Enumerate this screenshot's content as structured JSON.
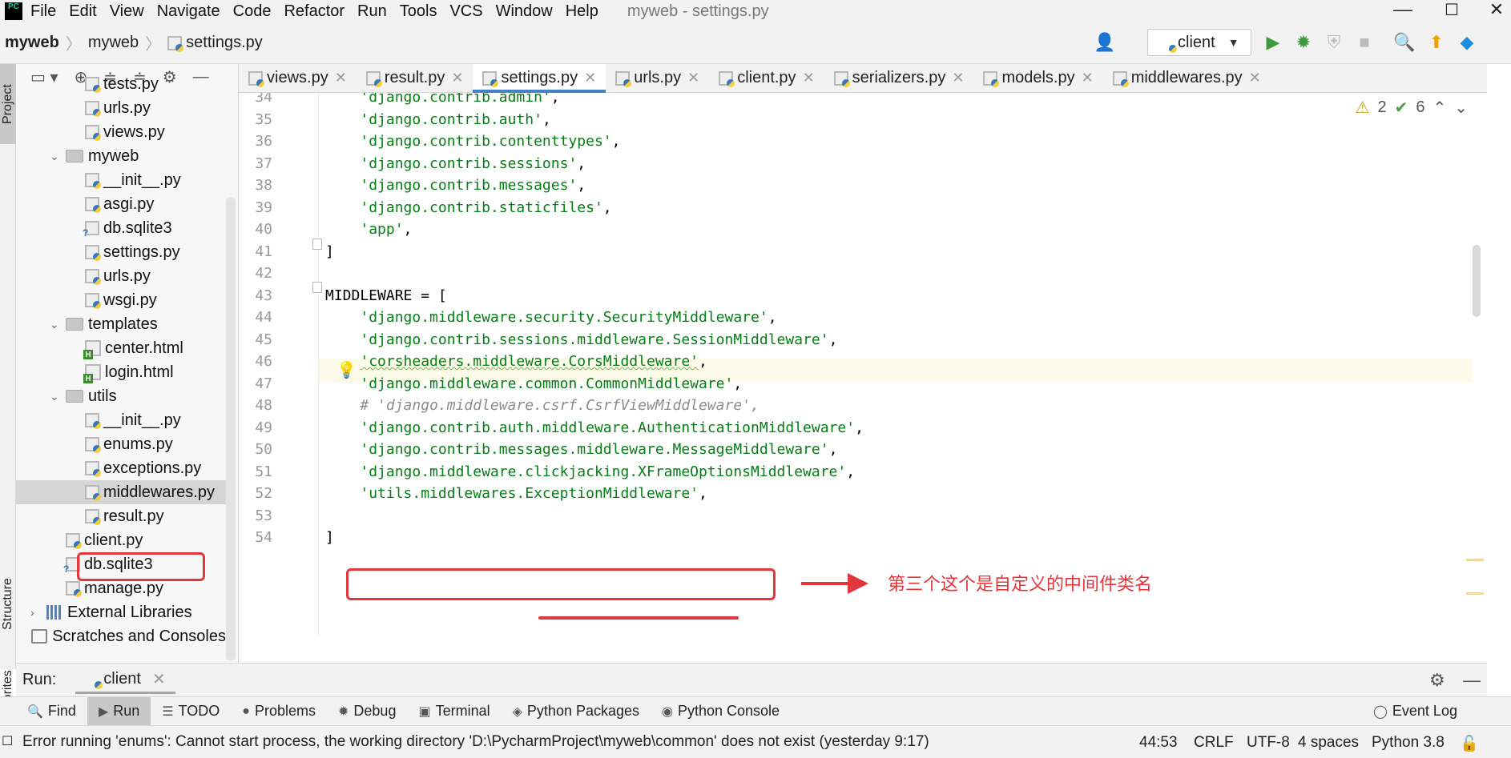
{
  "menubar": {
    "logo": "PC",
    "items": [
      "File",
      "Edit",
      "View",
      "Navigate",
      "Code",
      "Refactor",
      "Run",
      "Tools",
      "VCS",
      "Window",
      "Help"
    ],
    "window_title": "myweb - settings.py"
  },
  "navbar": {
    "breadcrumbs": [
      "myweb",
      "myweb",
      "settings.py"
    ],
    "run_config": "client"
  },
  "left_strip": {
    "project": "Project",
    "structure": "Structure",
    "favorites": "Favorites"
  },
  "tree": [
    {
      "label": "tests.py",
      "type": "py",
      "indent": 3
    },
    {
      "label": "urls.py",
      "type": "py",
      "indent": 3
    },
    {
      "label": "views.py",
      "type": "py",
      "indent": 3
    },
    {
      "label": "myweb",
      "type": "folder",
      "indent": 2,
      "expanded": true
    },
    {
      "label": "__init__.py",
      "type": "py",
      "indent": 3
    },
    {
      "label": "asgi.py",
      "type": "py",
      "indent": 3
    },
    {
      "label": "db.sqlite3",
      "type": "db",
      "indent": 3
    },
    {
      "label": "settings.py",
      "type": "py",
      "indent": 3
    },
    {
      "label": "urls.py",
      "type": "py",
      "indent": 3
    },
    {
      "label": "wsgi.py",
      "type": "py",
      "indent": 3
    },
    {
      "label": "templates",
      "type": "folder",
      "indent": 2,
      "expanded": true
    },
    {
      "label": "center.html",
      "type": "html",
      "indent": 3
    },
    {
      "label": "login.html",
      "type": "html",
      "indent": 3
    },
    {
      "label": "utils",
      "type": "folder",
      "indent": 2,
      "expanded": true
    },
    {
      "label": "__init__.py",
      "type": "py",
      "indent": 3
    },
    {
      "label": "enums.py",
      "type": "py",
      "indent": 3
    },
    {
      "label": "exceptions.py",
      "type": "py",
      "indent": 3
    },
    {
      "label": "middlewares.py",
      "type": "py",
      "indent": 3,
      "selected": true
    },
    {
      "label": "result.py",
      "type": "py",
      "indent": 3
    },
    {
      "label": "client.py",
      "type": "py",
      "indent": 2
    },
    {
      "label": "db.sqlite3",
      "type": "db",
      "indent": 2
    },
    {
      "label": "manage.py",
      "type": "py",
      "indent": 2
    },
    {
      "label": "External Libraries",
      "type": "lib",
      "indent": 1,
      "collapsed": true
    },
    {
      "label": "Scratches and Consoles",
      "type": "scratch",
      "indent": 1
    }
  ],
  "editor_tabs": [
    {
      "label": "views.py",
      "active": false
    },
    {
      "label": "result.py",
      "active": false
    },
    {
      "label": "settings.py",
      "active": true
    },
    {
      "label": "urls.py",
      "active": false
    },
    {
      "label": "client.py",
      "active": false
    },
    {
      "label": "serializers.py",
      "active": false
    },
    {
      "label": "models.py",
      "active": false
    },
    {
      "label": "middlewares.py",
      "active": false
    }
  ],
  "inspection": {
    "warnings": "2",
    "passed": "6"
  },
  "code_lines": [
    {
      "no": "34",
      "indent": "    ",
      "str": "'django.contrib.admin'",
      "tail": ","
    },
    {
      "no": "35",
      "indent": "    ",
      "str": "'django.contrib.auth'",
      "tail": ","
    },
    {
      "no": "36",
      "indent": "    ",
      "str": "'django.contrib.contenttypes'",
      "tail": ","
    },
    {
      "no": "37",
      "indent": "    ",
      "str": "'django.contrib.sessions'",
      "tail": ","
    },
    {
      "no": "38",
      "indent": "    ",
      "str": "'django.contrib.messages'",
      "tail": ","
    },
    {
      "no": "39",
      "indent": "    ",
      "str": "'django.contrib.staticfiles'",
      "tail": ","
    },
    {
      "no": "40",
      "indent": "    ",
      "str": "'app'",
      "tail": ","
    },
    {
      "no": "41",
      "indent": "",
      "plain": "]"
    },
    {
      "no": "42",
      "indent": "",
      "plain": ""
    },
    {
      "no": "43",
      "indent": "",
      "plain": "MIDDLEWARE = ["
    },
    {
      "no": "44",
      "indent": "    ",
      "str": "'django.middleware.security.SecurityMiddleware'",
      "tail": ","
    },
    {
      "no": "45",
      "indent": "    ",
      "str": "'django.contrib.sessions.middleware.SessionMiddleware'",
      "tail": ","
    },
    {
      "no": "46",
      "indent": "    ",
      "str": "'corsheaders.middleware.CorsMiddleware'",
      "tail": ",",
      "squiggle": true
    },
    {
      "no": "47",
      "indent": "    ",
      "str": "'django.middleware.common.CommonMiddleware'",
      "tail": ","
    },
    {
      "no": "48",
      "indent": "    ",
      "comment": "# 'django.middleware.csrf.CsrfViewMiddleware',"
    },
    {
      "no": "49",
      "indent": "    ",
      "str": "'django.contrib.auth.middleware.AuthenticationMiddleware'",
      "tail": ","
    },
    {
      "no": "50",
      "indent": "    ",
      "str": "'django.contrib.messages.middleware.MessageMiddleware'",
      "tail": ","
    },
    {
      "no": "51",
      "indent": "    ",
      "str": "'django.middleware.clickjacking.XFrameOptionsMiddleware'",
      "tail": ","
    },
    {
      "no": "52",
      "indent": "    ",
      "str": "'utils.middlewares.ExceptionMiddleware'",
      "tail": ","
    },
    {
      "no": "53",
      "indent": "",
      "plain": ""
    },
    {
      "no": "54",
      "indent": "",
      "plain": "]"
    }
  ],
  "annotation": {
    "text": "第三个这个是自定义的中间件类名",
    "color": "#e0363c"
  },
  "run_bar": {
    "label": "Run:",
    "tab": "client"
  },
  "tool_buttons": [
    {
      "label": "Find",
      "icon": "search-icon",
      "active": false
    },
    {
      "label": "Run",
      "icon": "run-icon",
      "active": true
    },
    {
      "label": "TODO",
      "icon": "list-icon",
      "active": false
    },
    {
      "label": "Problems",
      "icon": "problems-icon",
      "active": false
    },
    {
      "label": "Debug",
      "icon": "bug-icon",
      "active": false
    },
    {
      "label": "Terminal",
      "icon": "terminal-icon",
      "active": false
    },
    {
      "label": "Python Packages",
      "icon": "packages-icon",
      "active": false
    },
    {
      "label": "Python Console",
      "icon": "console-icon",
      "active": false
    }
  ],
  "event_log": "Event Log",
  "status": {
    "message": "Error running 'enums': Cannot start process, the working directory 'D:\\PycharmProject\\myweb\\common' does not exist (yesterday 9:17)",
    "position": "44:53",
    "line_sep": "CRLF",
    "encoding": "UTF-8",
    "indent": "4 spaces",
    "interpreter": "Python 3.8"
  },
  "colors": {
    "accent": "#4083c9",
    "string": "#067d17",
    "annotation": "#e0363c"
  }
}
